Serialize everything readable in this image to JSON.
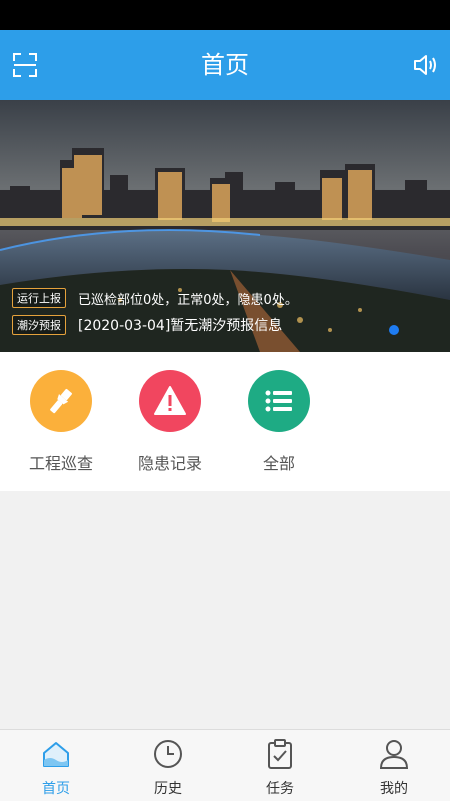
{
  "header": {
    "title": "首页"
  },
  "banner": {
    "ticker_tag": "运行上报",
    "ticker_text": "已巡检部位0处，正常0处，隐患0处。",
    "tide_tag": "潮汐预报",
    "tide_text": "[2020-03-04]暂无潮汐预报信息"
  },
  "shortcuts": [
    {
      "label": "工程巡查",
      "icon": "flashlight-icon",
      "color": "#fbb03b"
    },
    {
      "label": "隐患记录",
      "icon": "warning-icon",
      "color": "#f1465f"
    },
    {
      "label": "全部",
      "icon": "list-icon",
      "color": "#1eab84"
    }
  ],
  "tabs": [
    {
      "label": "首页",
      "icon": "home-icon",
      "active": true
    },
    {
      "label": "历史",
      "icon": "clock-icon",
      "active": false
    },
    {
      "label": "任务",
      "icon": "clipboard-check-icon",
      "active": false
    },
    {
      "label": "我的",
      "icon": "user-icon",
      "active": false
    }
  ],
  "colors": {
    "primary": "#2d9ee9",
    "active_dot": "#1e7cf2"
  }
}
